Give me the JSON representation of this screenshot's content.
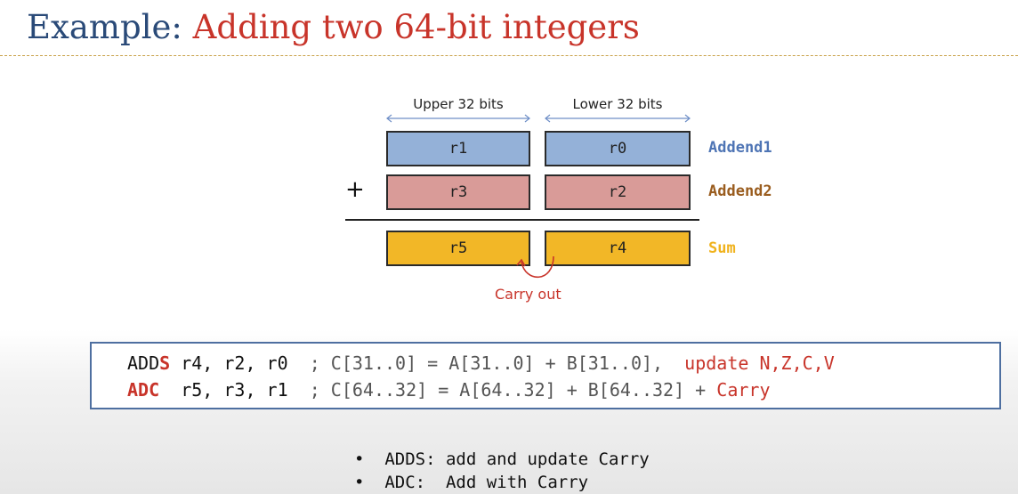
{
  "title": {
    "prefix": "Example: ",
    "highlight": "Adding two 64-bit integers"
  },
  "diagram": {
    "upper_header": "Upper 32 bits",
    "lower_header": "Lower 32 bits",
    "rows": [
      {
        "upper": "r1",
        "lower": "r0",
        "label": "Addend1",
        "fill": "#94b1d8",
        "label_color": "#4f75b5"
      },
      {
        "upper": "r3",
        "lower": "r2",
        "label": "Addend2",
        "fill": "#d99b98",
        "label_color": "#9a5d1f"
      },
      {
        "upper": "r5",
        "lower": "r4",
        "label": "Sum",
        "fill": "#f2b727",
        "label_color": "#f0b21c"
      }
    ],
    "plus": "+",
    "carry_label": "Carry out"
  },
  "code": {
    "line1": {
      "op_plain": "ADD",
      "op_suffix": "S",
      "args": " r4, r2, r0  ",
      "comment": "; C[31..0] = A[31..0] + B[31..0],",
      "comment_red": "  update N,Z,C,V"
    },
    "line2": {
      "op": "ADC",
      "args": "  r5, r3, r1  ",
      "comment": "; C[64..32] = A[64..32] + B[64..32] +",
      "comment_red": " Carry"
    }
  },
  "notes": [
    "ADDS: add and update Carry",
    "ADC:  Add with Carry"
  ],
  "colors": {
    "title_blue": "#2a4a78",
    "accent_red": "#c8342a",
    "dim_arrow": "#6f8fc7"
  }
}
